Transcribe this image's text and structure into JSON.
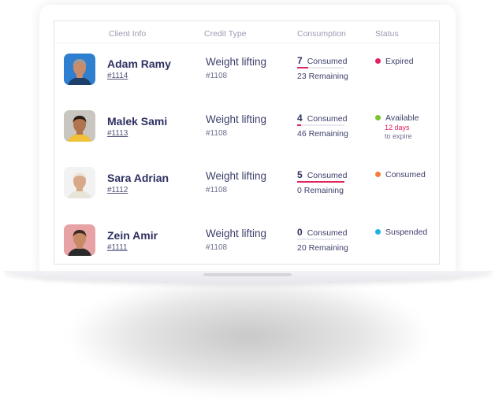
{
  "table": {
    "columns": [
      "",
      "Client Info",
      "Credit Type",
      "Consumption",
      "Status"
    ],
    "rows": [
      {
        "name": "Adam Ramy",
        "client_id": "#1114",
        "credit_type": "Weight lifting",
        "credit_code": "#1108",
        "consumed": "7",
        "consumed_label": "Consumed",
        "remaining": "23 Remaining",
        "consumed_fraction": 0.23,
        "status": "Expired",
        "status_color": "#e0245e",
        "status_note1": "",
        "status_note2": ""
      },
      {
        "name": "Malek Sami",
        "client_id": "#1113",
        "credit_type": "Weight lifting",
        "credit_code": "#1108",
        "consumed": "4",
        "consumed_label": "Consumed",
        "remaining": "46 Remaining",
        "consumed_fraction": 0.08,
        "status": "Available",
        "status_color": "#7cc32c",
        "status_note1": "12 days",
        "status_note2": "to expire"
      },
      {
        "name": "Sara Adrian",
        "client_id": "#1112",
        "credit_type": "Weight lifting",
        "credit_code": "#1108",
        "consumed": "5",
        "consumed_label": "Consumed",
        "remaining": "0 Remaining",
        "consumed_fraction": 1.0,
        "status": "Consumed",
        "status_color": "#f47c3c",
        "status_note1": "",
        "status_note2": ""
      },
      {
        "name": "Zein Amir",
        "client_id": "#1111",
        "credit_type": "Weight lifting",
        "credit_code": "#1108",
        "consumed": "0",
        "consumed_label": "Consumed",
        "remaining": "20 Remaining",
        "consumed_fraction": 0.0,
        "status": "Suspended",
        "status_color": "#1fb3e0",
        "status_note1": "",
        "status_note2": ""
      }
    ]
  },
  "avatars": [
    {
      "icon": "avatar-adam-ramy",
      "bg": "#2f7fd0",
      "skin": "#c98c6a",
      "hair": "#9a9a9a",
      "shirt": "#1e3f6a"
    },
    {
      "icon": "avatar-malek-sami",
      "bg": "#c9c5c0",
      "skin": "#b0744e",
      "hair": "#2a1d15",
      "shirt": "#f0c23a"
    },
    {
      "icon": "avatar-sara-adrian",
      "bg": "#f2f2f2",
      "skin": "#d8a888",
      "hair": "#ebe6dc",
      "shirt": "#e9e4da"
    },
    {
      "icon": "avatar-zein-amir",
      "bg": "#e7a2a6",
      "skin": "#c68a66",
      "hair": "#3a2a20",
      "shirt": "#2a2a2a"
    }
  ]
}
